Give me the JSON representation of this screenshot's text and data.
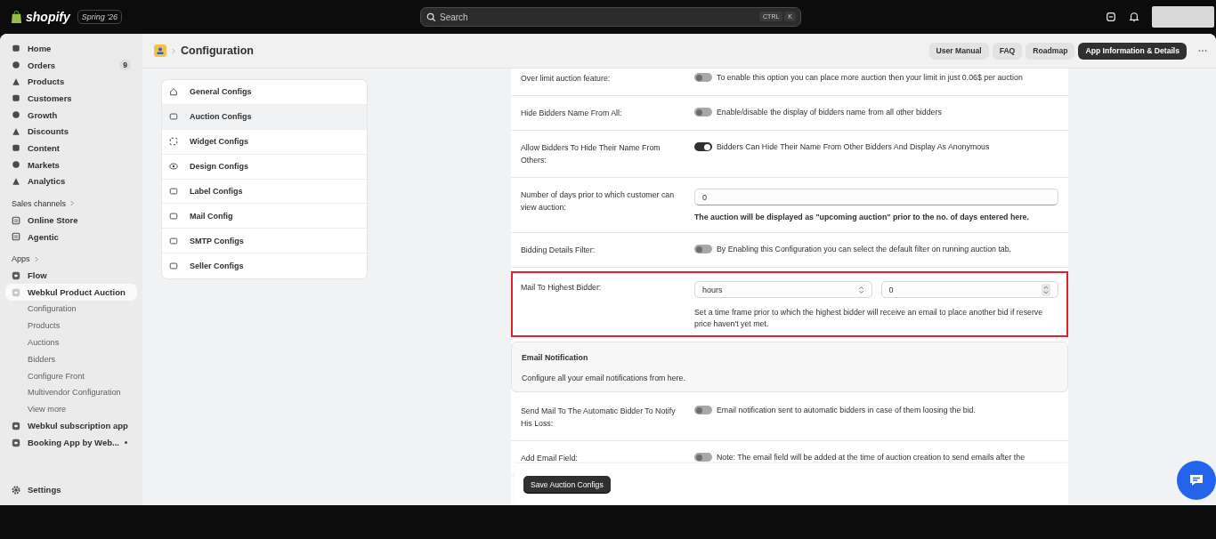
{
  "topbar": {
    "brand": "shopify",
    "edition": "Spring '26",
    "search": {
      "placeholder": "Search",
      "keys": [
        "CTRL",
        "K"
      ]
    }
  },
  "sidebar": {
    "items": [
      {
        "label": "Home",
        "selected": false
      },
      {
        "label": "Orders",
        "badge": "9",
        "selected": false
      },
      {
        "label": "Products",
        "selected": false
      },
      {
        "label": "Customers",
        "selected": false
      },
      {
        "label": "Growth",
        "selected": false
      },
      {
        "label": "Discounts",
        "selected": false
      },
      {
        "label": "Content",
        "selected": false
      },
      {
        "label": "Markets",
        "selected": false
      },
      {
        "label": "Analytics",
        "selected": false
      }
    ],
    "sales_channels": {
      "heading": "Sales channels",
      "items": [
        {
          "label": "Online Store"
        },
        {
          "label": "Agentic"
        }
      ]
    },
    "apps": {
      "heading": "Apps",
      "items": [
        {
          "label": "Flow",
          "selected": false
        },
        {
          "label": "Webkul Product Auction",
          "selected": true,
          "children": [
            {
              "label": "Configuration"
            },
            {
              "label": "Products"
            },
            {
              "label": "Auctions"
            },
            {
              "label": "Bidders"
            },
            {
              "label": "Configure Front"
            },
            {
              "label": "Multivendor Configuration"
            },
            {
              "label": "View more"
            }
          ]
        },
        {
          "label": "Webkul subscription app",
          "selected": false
        },
        {
          "label": "Booking App by Web...",
          "selected": false,
          "dot": true
        }
      ]
    },
    "settings": "Settings"
  },
  "header": {
    "title": "Configuration",
    "buttons": [
      {
        "label": "User Manual",
        "primary": false
      },
      {
        "label": "FAQ",
        "primary": false
      },
      {
        "label": "Roadmap",
        "primary": false
      },
      {
        "label": "App Information & Details",
        "primary": true
      }
    ]
  },
  "config_nav": [
    {
      "label": "General Configs",
      "selected": false
    },
    {
      "label": "Auction Configs",
      "selected": true
    },
    {
      "label": "Widget Configs",
      "selected": false
    },
    {
      "label": "Design Configs",
      "selected": false
    },
    {
      "label": "Label Configs",
      "selected": false
    },
    {
      "label": "Mail Config",
      "selected": false
    },
    {
      "label": "SMTP Configs",
      "selected": false
    },
    {
      "label": "Seller Configs",
      "selected": false
    }
  ],
  "settings_rows": [
    {
      "kind": "toggle",
      "label": "Over limit auction feature:",
      "on": false,
      "description": "To enable this option you can place more auction then your limit in just 0.06$ per auction",
      "highlighted": false
    },
    {
      "kind": "toggle",
      "label": "Hide Bidders Name From All:",
      "on": false,
      "description": "Enable/disable the display of bidders name from all other bidders",
      "highlighted": false
    },
    {
      "kind": "toggle",
      "label": "Allow Bidders To Hide Their Name From Others:",
      "on": true,
      "description": "Bidders Can Hide Their Name From Other Bidders And Display As Anonymous",
      "highlighted": false
    },
    {
      "kind": "number",
      "label": "Number of days prior to which customer can view auction:",
      "value": "0",
      "description": "The auction will be displayed as \"upcoming auction\" prior to the no. of days entered here.",
      "highlighted": false
    },
    {
      "kind": "toggle",
      "label": "Bidding Details Filter:",
      "on": false,
      "description": "By Enabling this Configuration you can select the default filter on running auction tab.",
      "highlighted": false
    },
    {
      "kind": "select_number",
      "label": "Mail To Highest Bidder:",
      "select_value": "hours",
      "value": "0",
      "description": "Set a time frame prior to which the highest bidder will receive an email to place another bid if reserve price haven't yet met.",
      "highlighted": true
    },
    {
      "kind": "section",
      "label": "Email Notification",
      "description": "Configure all your email notifications from here.",
      "highlighted": false
    },
    {
      "kind": "toggle",
      "label": "Send Mail To The Automatic Bidder To Notify His Loss:",
      "on": false,
      "description": "Email notification sent to automatic bidders in case of them loosing the bid.",
      "highlighted": false
    },
    {
      "kind": "toggle",
      "label": "Add Email Field:",
      "on": false,
      "description": "Note: The email field will be added at the time of auction creation to send emails after the",
      "highlighted": false
    }
  ],
  "save_button": "Save Auction Configs"
}
